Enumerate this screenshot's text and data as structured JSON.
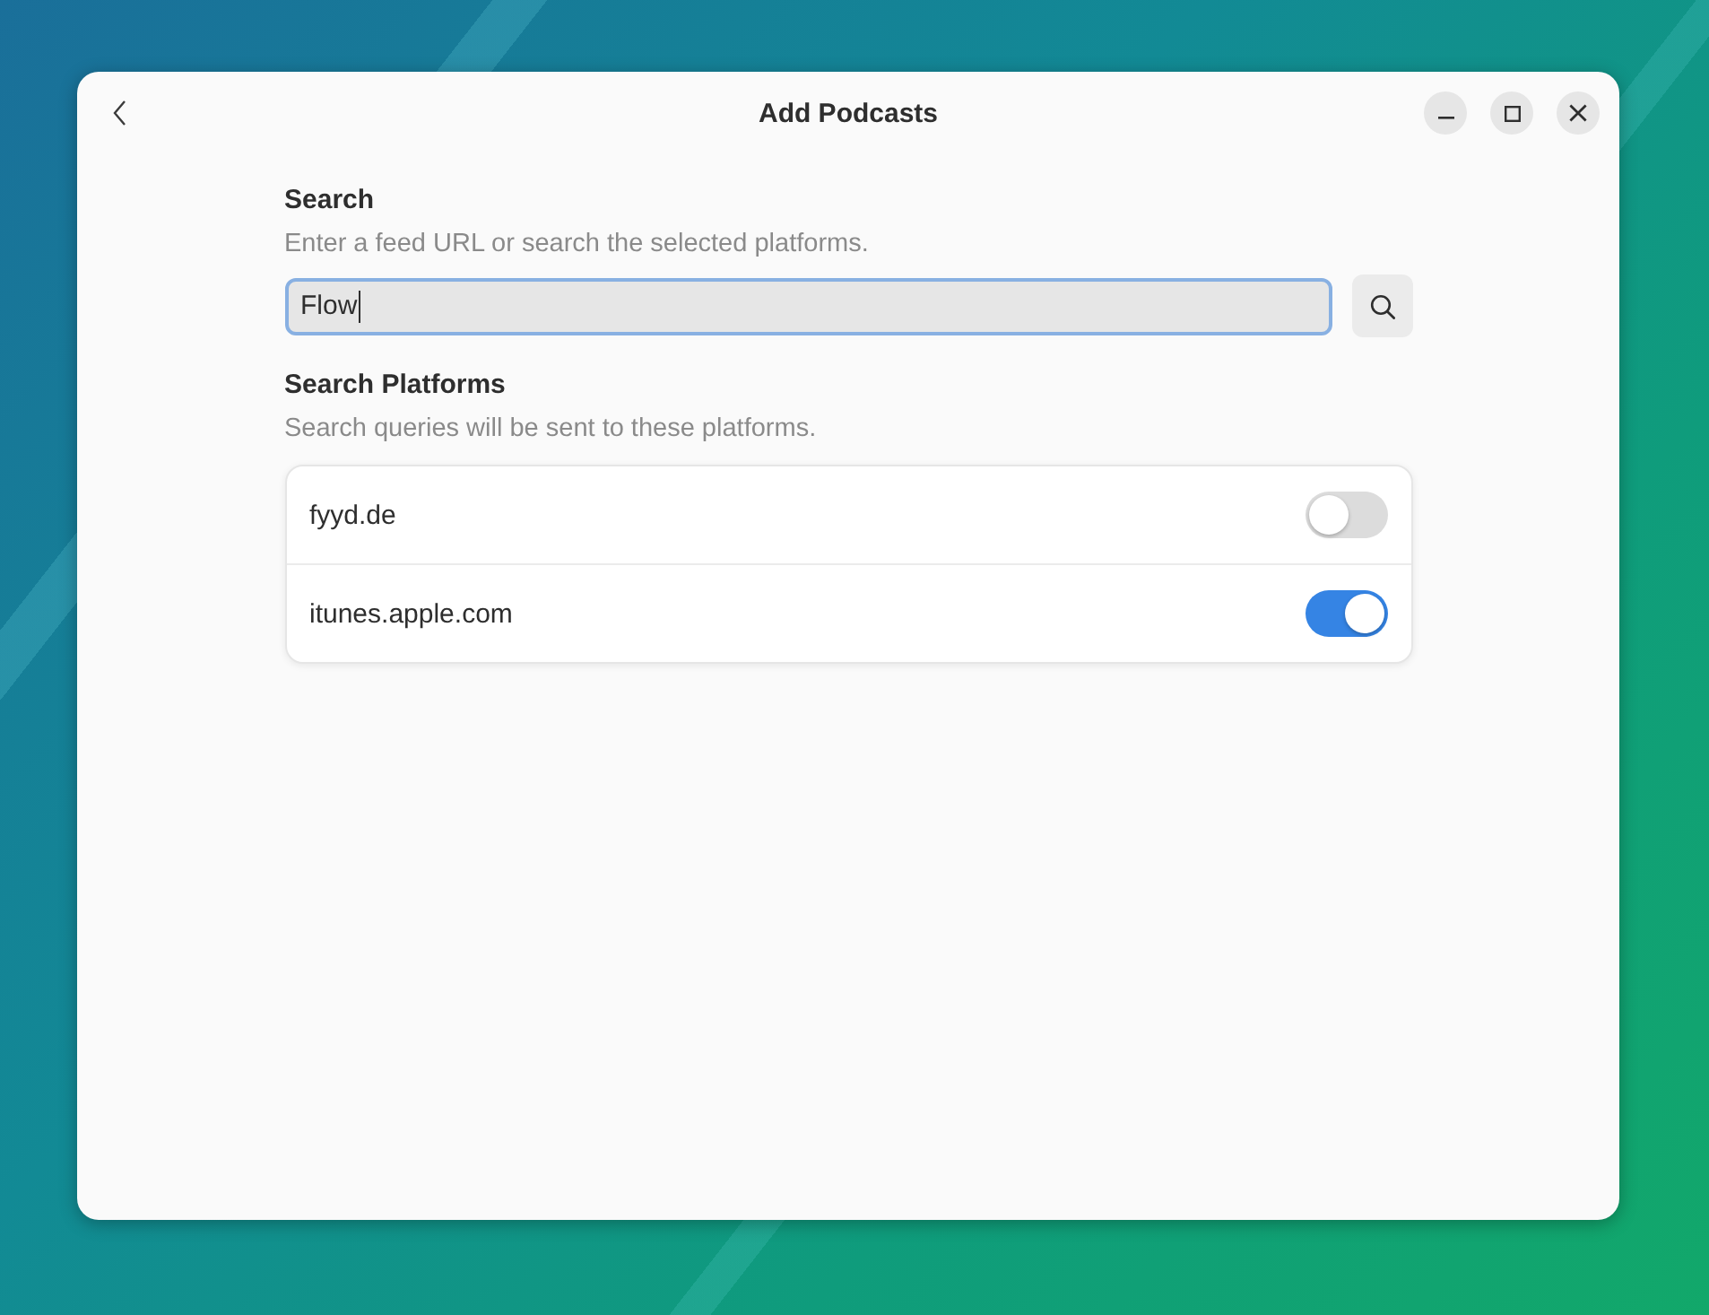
{
  "window": {
    "title": "Add Podcasts"
  },
  "search": {
    "heading": "Search",
    "description": "Enter a feed URL or search the selected platforms.",
    "value": "Flow",
    "focused": true
  },
  "platforms": {
    "heading": "Search Platforms",
    "description": "Search queries will be sent to these platforms.",
    "items": [
      {
        "name": "fyyd.de",
        "on": false
      },
      {
        "name": "itunes.apple.com",
        "on": true
      }
    ]
  }
}
